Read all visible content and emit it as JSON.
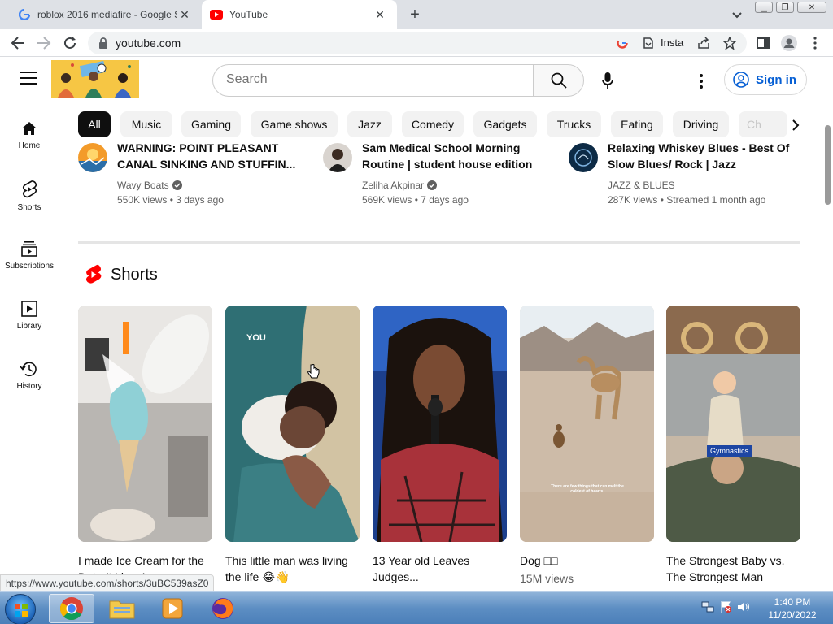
{
  "browser": {
    "tabs": [
      {
        "title": "roblox 2016 mediafire - Google S",
        "favicon": "google-icon",
        "active": false
      },
      {
        "title": "YouTube",
        "favicon": "youtube-icon",
        "active": true
      }
    ],
    "url": "youtube.com",
    "extension_label": "Insta"
  },
  "header": {
    "search_placeholder": "Search",
    "signin_label": "Sign in"
  },
  "sidebar": {
    "items": [
      {
        "label": "Home",
        "icon": "home-icon"
      },
      {
        "label": "Shorts",
        "icon": "shorts-icon"
      },
      {
        "label": "Subscriptions",
        "icon": "subscriptions-icon"
      },
      {
        "label": "Library",
        "icon": "library-icon"
      },
      {
        "label": "History",
        "icon": "history-icon"
      }
    ]
  },
  "chips": [
    "All",
    "Music",
    "Gaming",
    "Game shows",
    "Jazz",
    "Comedy",
    "Gadgets",
    "Trucks",
    "Eating",
    "Driving",
    "Ch"
  ],
  "videos": [
    {
      "title_line1": "WARNING: POINT PLEASANT",
      "title_line2": "CANAL SINKING AND STUFFIN...",
      "channel": "Wavy Boats",
      "meta": "550K views • 3 days ago"
    },
    {
      "title_line1": "Sam Medical School Morning",
      "title_line2": "Routine | student house edition",
      "channel": "Zeliha Akpinar",
      "meta": "569K views • 7 days ago"
    },
    {
      "title_line1": "Relaxing Whiskey Blues - Best Of",
      "title_line2": "Slow Blues/ Rock | Jazz",
      "channel": "JAZZ & BLUES",
      "meta": "287K views • Streamed 1 month ago"
    }
  ],
  "shorts": {
    "heading": "Shorts",
    "items": [
      {
        "title": "I made Ice Cream for the Detroit Lions!",
        "views": "",
        "overlay": ""
      },
      {
        "title": "This little man was living the life 😂👋",
        "views": "",
        "overlay": "YOU"
      },
      {
        "title": "13 Year old Leaves Judges...",
        "views": "",
        "overlay": ""
      },
      {
        "title": "Dog □□",
        "views": "15M views",
        "overlay": "There are few things that can melt the coldest of hearts."
      },
      {
        "title": "The Strongest Baby vs. The Strongest Man",
        "views": "",
        "overlay": "Gymnastics"
      }
    ]
  },
  "status_url": "https://www.youtube.com/shorts/3uBC539asZ0",
  "taskbar": {
    "time": "1:40 PM",
    "date": "11/20/2022"
  },
  "colors": {
    "youtube_red": "#ff0000",
    "link_blue": "#065fd4",
    "chip_active": "#0f0f0f"
  }
}
